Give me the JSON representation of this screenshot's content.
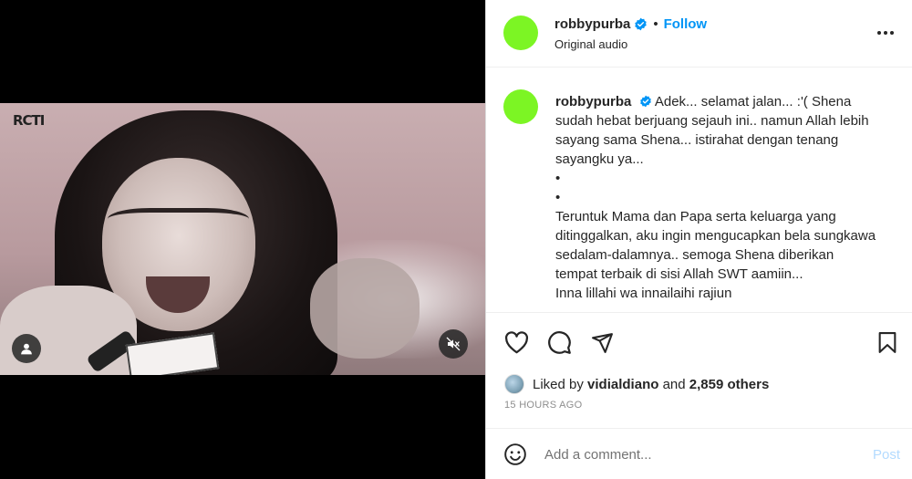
{
  "media": {
    "channel_logo_text": "RCTI",
    "user_icon": "user-icon",
    "mute_icon": "speaker-muted-icon"
  },
  "header": {
    "username": "robbypurba",
    "separator": "•",
    "follow_label": "Follow",
    "subtitle": "Original audio",
    "more_icon": "more-horizontal-icon",
    "avatar_color": "#7cf524"
  },
  "caption": {
    "username": "robbypurba",
    "paragraph1": "Adek... selamat jalan... :'( Shena sudah hebat berjuang sejauh ini.. namun Allah lebih sayang sama Shena... istirahat dengan tenang sayangku ya...",
    "bullet1": "•",
    "bullet2": "•",
    "paragraph2": "Teruntuk Mama dan Papa serta keluarga yang ditinggalkan, aku ingin mengucapkan bela sungkawa sedalam-dalamnya.. semoga Shena diberikan tempat terbaik di sisi Allah SWT aamiin...",
    "paragraph3": "Inna lillahi wa innailaihi rajiun"
  },
  "actions": {
    "like_icon": "heart-icon",
    "comment_icon": "comment-bubble-icon",
    "share_icon": "paper-plane-icon",
    "save_icon": "bookmark-icon"
  },
  "likes": {
    "prefix": "Liked by",
    "user": "vidialdiano",
    "connector": "and",
    "others": "2,859 others"
  },
  "timestamp": "15 HOURS AGO",
  "add_comment": {
    "placeholder": "Add a comment...",
    "post_label": "Post",
    "emoji_icon": "smiley-icon"
  },
  "colors": {
    "accent": "#0095f6",
    "verified": "#0095f6",
    "post_disabled": "#b3dbff"
  }
}
